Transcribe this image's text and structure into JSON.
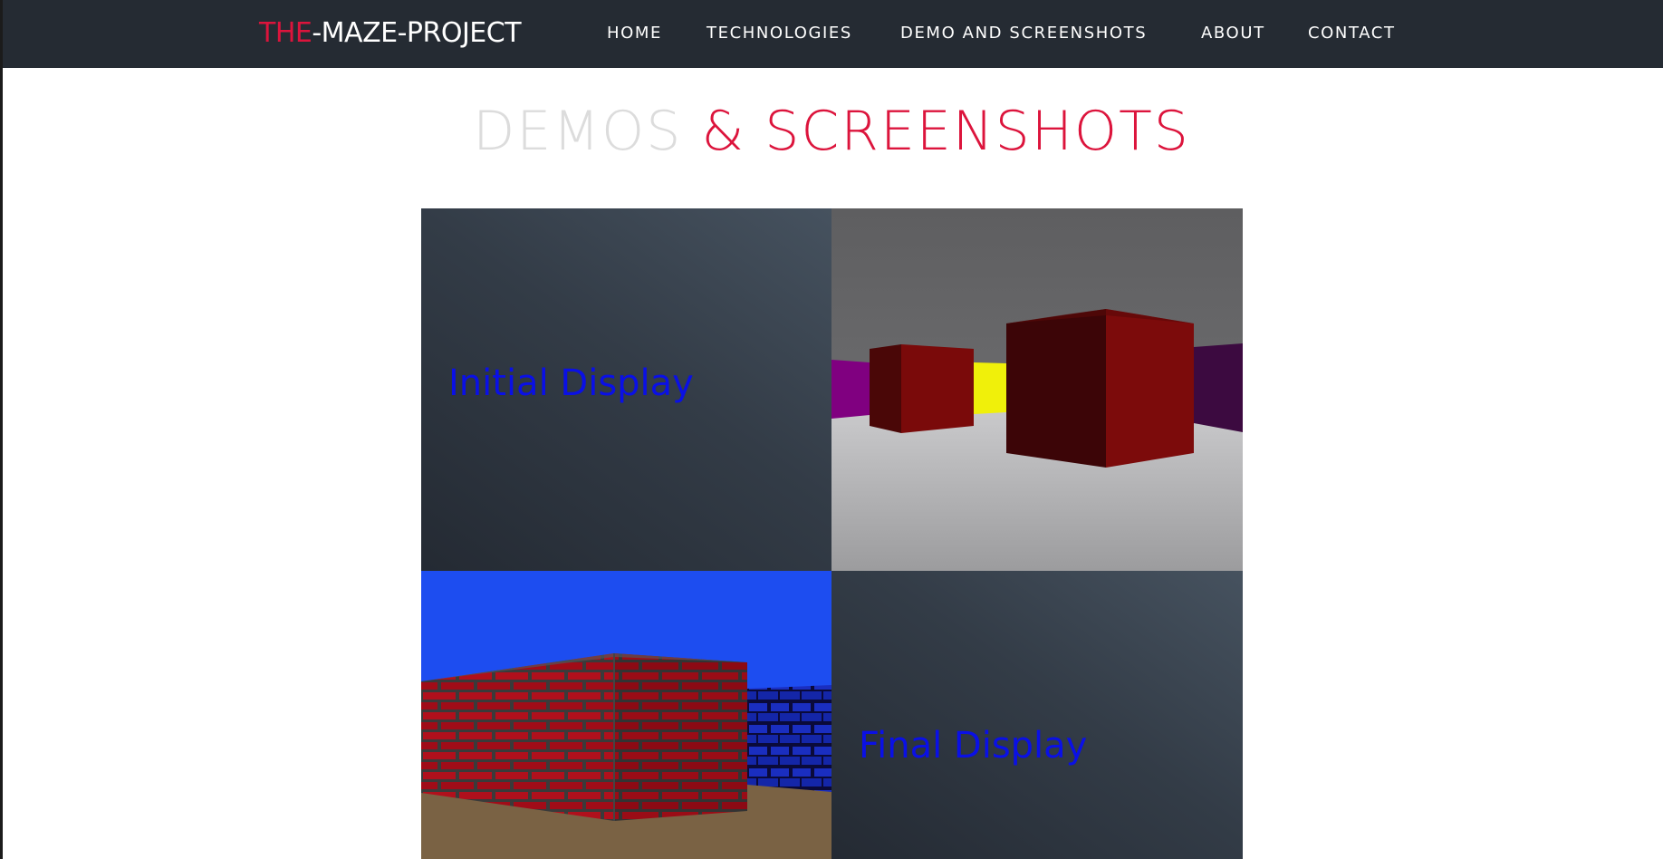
{
  "brand": {
    "prefix": "THE",
    "suffix": "-MAZE-PROJECT"
  },
  "nav": {
    "items": [
      {
        "label": "HOME"
      },
      {
        "label": "TECHNOLOGIES"
      },
      {
        "label": "DEMO AND SCREENSHOTS"
      },
      {
        "label": "ABOUT"
      },
      {
        "label": "CONTACT"
      }
    ]
  },
  "heading": {
    "part1": "DEMOS",
    "part2": "& SCREENSHOTS"
  },
  "gallery": {
    "initial_label": "Initial Display",
    "final_label": "Final Display"
  },
  "colors": {
    "navbar_bg": "#252b33",
    "accent": "#dc143c",
    "heading_muted": "#dcdcdc",
    "tile_label": "#0a10e6"
  }
}
